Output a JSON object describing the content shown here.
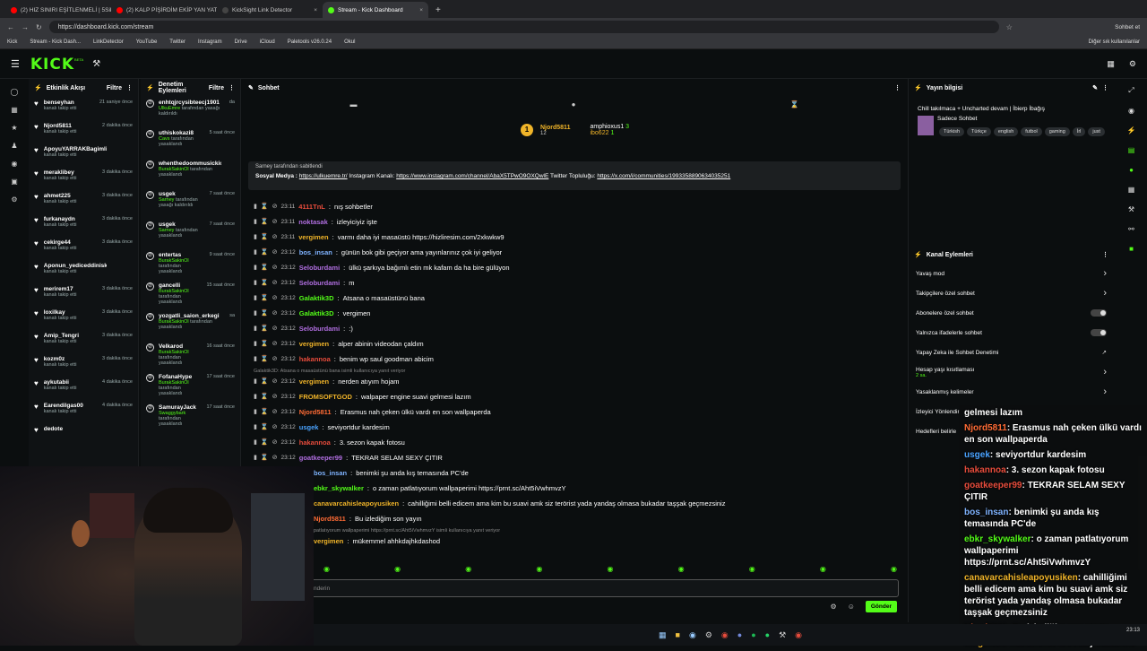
{
  "browser": {
    "tabs": [
      {
        "label": "(2) HIZ SINIRI EŞİTLENMELİ | 5Sik...",
        "icon": "youtube-icon",
        "color": "#ff0000"
      },
      {
        "label": "(2) KALP PİŞİRDİM EKİP YAN YATTI...",
        "icon": "youtube-icon",
        "color": "#ff0000"
      },
      {
        "label": "KickSight Link Detector",
        "icon": "kicksight-icon",
        "color": "#444444"
      },
      {
        "label": "Stream - Kick Dashboard",
        "icon": "kick-icon",
        "color": "#53fc18"
      }
    ],
    "url": "https://dashboard.kick.com/stream",
    "profile_label": "Sohbet et",
    "bookmarks": [
      "Kick",
      "Stream - Kick Dash...",
      "LinkDetector",
      "YouTube",
      "Twitter",
      "Instagram",
      "Drive",
      "iCloud",
      "Paletools v26.0.24",
      "Okul"
    ],
    "other_bookmarks": "Diğer sık kullanılanlar"
  },
  "kick": {
    "logo": "KICK",
    "logo_sup": "BETA"
  },
  "activity": {
    "title": "Etkinlik Akışı",
    "filter": "Filtre",
    "items": [
      {
        "name": "benseyhan",
        "sub": "kanalı takip etti",
        "time": "21 saniye önce"
      },
      {
        "name": "Njord5811",
        "sub": "kanalı takip etti",
        "time": "2 dakika önce"
      },
      {
        "name": "ApoyuYARRAKBagimlisiYap",
        "sub": "kanalı takip etti",
        "time": ""
      },
      {
        "name": "meraklibey",
        "sub": "kanalı takip etti",
        "time": "3 dakika önce"
      },
      {
        "name": "ahmet225",
        "sub": "kanalı takip etti",
        "time": "3 dakika önce"
      },
      {
        "name": "furkanaydn",
        "sub": "kanalı takip etti",
        "time": "3 dakika önce"
      },
      {
        "name": "cekirge44",
        "sub": "kanalı takip etti",
        "time": "3 dakika önce"
      },
      {
        "name": "Aponun_yediceddinisken",
        "sub": "kanalı takip etti",
        "time": ""
      },
      {
        "name": "merirem17",
        "sub": "kanalı takip etti",
        "time": "3 dakika önce"
      },
      {
        "name": "loxilkay",
        "sub": "kanalı takip etti",
        "time": "3 dakika önce"
      },
      {
        "name": "Amip_Tengri",
        "sub": "kanalı takip etti",
        "time": "3 dakika önce"
      },
      {
        "name": "kozm0z",
        "sub": "kanalı takip etti",
        "time": "3 dakika önce"
      },
      {
        "name": "aykutabii",
        "sub": "kanalı takip etti",
        "time": "4 dakika önce"
      },
      {
        "name": "Earendilgas00",
        "sub": "kanalı takip etti",
        "time": "4 dakika önce"
      },
      {
        "name": "dedote",
        "sub": "",
        "time": ""
      }
    ]
  },
  "moderation": {
    "title": "Denetim Eylemleri",
    "filter": "Filtre",
    "items": [
      {
        "name": "enhtqjrcysibteecj1901",
        "by": "UlkuEmre",
        "desc": "tarafından yasağı kaldırıldı",
        "time": "da"
      },
      {
        "name": "uthiskokazi8",
        "by": "Cavs",
        "desc": "tarafından yasaklandı",
        "time": "5 saat önce"
      },
      {
        "name": "whenthedoommusickicl",
        "by": "BurakSakinOl",
        "desc": "tarafından yasaklandı",
        "time": ""
      },
      {
        "name": "usgek",
        "by": "Sarney",
        "desc": "tarafından yasağı kaldırıldı",
        "time": "7 saat önce"
      },
      {
        "name": "usgek",
        "by": "Sarney",
        "desc": "tarafından yasaklandı",
        "time": "7 saat önce"
      },
      {
        "name": "entertas",
        "by": "BurakSakinOl",
        "desc": "tarafından yasaklandı",
        "time": "9 saat önce"
      },
      {
        "name": "gancelli",
        "by": "BurakSakinOl",
        "desc": "tarafından yasaklandı",
        "time": "15 saat önce"
      },
      {
        "name": "yozgatli_saion_erkegi",
        "by": "BurakSakinOl",
        "desc": "tarafından yasaklandı",
        "time": "sa"
      },
      {
        "name": "Velkarod",
        "by": "BurakSakinOl",
        "desc": "tarafından yasaklandı",
        "time": "16 saat önce"
      },
      {
        "name": "FofanaHype",
        "by": "BurakSakinOl",
        "desc": "tarafından yasaklandı",
        "time": "17 saat önce"
      },
      {
        "name": "SamurayJack",
        "by": "Swaggybark",
        "desc": "tarafından yasaklandı",
        "time": "17 saat önce"
      }
    ]
  },
  "chat": {
    "title": "Sohbet",
    "leaders": {
      "top": "Njord5811",
      "top_count": "12",
      "second": "amphioxus1",
      "second_count": "3",
      "third": "ibo622",
      "third_count": "1"
    },
    "pinned": {
      "by": "Sarney tarafından sabitlendi",
      "text_prefix": "Sosyal Medya :",
      "link1": "https://ulkuemre.tr/",
      "text_mid": "Instagram Kanalı:",
      "link2": "https://www.instagram.com/channel/AbaX5TPwO9OXQwlE",
      "text_mid2": "Twitter Topluluğu:",
      "link3": "https://x.com/i/communities/1993358890634035251"
    },
    "messages": [
      {
        "time": "23:11",
        "user": "4111TnL",
        "color": "#e74c3c",
        "text": "nış sohbetler"
      },
      {
        "time": "23:11",
        "user": "noktasak",
        "color": "#b06ee0",
        "text": "izleyiciyiz işte"
      },
      {
        "time": "23:11",
        "user": "vergimen",
        "color": "#f0b429",
        "text": "varmı daha iyi masaüstü https://hizliresim.com/2xkwkw9"
      },
      {
        "time": "23:12",
        "user": "bos_insan",
        "color": "#7fb3ff",
        "text": "günün bok gibi geçiyor ama yayınlarınız çok iyi geliyor"
      },
      {
        "time": "23:12",
        "user": "Seloburdami",
        "color": "#b06ee0",
        "text": "ülkü şarkıya bağımlı etin mk kafam da ha bire gülüyon"
      },
      {
        "time": "23:12",
        "user": "Seloburdami",
        "color": "#b06ee0",
        "text": "m"
      },
      {
        "time": "23:12",
        "user": "Galaktik3D",
        "color": "#53fc18",
        "text": "Atsana o masaüstünü bana"
      },
      {
        "time": "23:12",
        "user": "Galaktik3D",
        "color": "#53fc18",
        "text": "vergimen"
      },
      {
        "time": "23:12",
        "user": "Seloburdami",
        "color": "#b06ee0",
        "text": ":)"
      },
      {
        "time": "23:12",
        "user": "vergimen",
        "color": "#f0b429",
        "text": "alper abinin videodan çaldım"
      },
      {
        "time": "23:12",
        "user": "hakannoa",
        "color": "#e74c3c",
        "text": "benim wp saul goodman abicim"
      },
      {
        "time": "23:12",
        "user": "vergimen",
        "color": "#f0b429",
        "text": "nerden atıyım hojam"
      },
      {
        "time": "23:12",
        "user": "FROMSOFTGOD",
        "color": "#f0b429",
        "text": "walpaper engine suavi gelmesi lazım"
      },
      {
        "time": "23:12",
        "user": "Njord5811",
        "color": "#ff6b35",
        "text": "Erasmus nah çeken ülkü vardı en son wallpaperda"
      },
      {
        "time": "23:12",
        "user": "usgek",
        "color": "#4aa3ff",
        "text": "seviyortdur kardesim"
      },
      {
        "time": "23:12",
        "user": "hakannoa",
        "color": "#e74c3c",
        "text": "3. sezon kapak fotosu"
      },
      {
        "time": "23:12",
        "user": "goatkeeper99",
        "color": "#b06ee0",
        "text": "TEKRAR SELAM SEXY ÇITIR"
      }
    ],
    "lower_messages": [
      {
        "user": "bos_insan",
        "color": "#7fb3ff",
        "text": "benimki şu anda kış temasında PC'de"
      },
      {
        "user": "ebkr_skywalker",
        "color": "#53fc18",
        "text": "o zaman patlatıyorum wallpaperimi https://prnt.sc/Aht5iVwhmvzY"
      },
      {
        "user": "canavarcahisleapoyusiken",
        "color": "#f0b429",
        "text": "cahilliğimi belli edicem ama kim bu suavi amk siz terörist yada yandaş olmasa bukadar taşşak geçmezsiniz"
      },
      {
        "user": "Njord5811",
        "color": "#ff6b35",
        "text": "Bu izlediğim son yayın"
      },
      {
        "user": "vergimen",
        "color": "#f0b429",
        "text": "mükemmel ahhkdajhkdashod"
      }
    ],
    "reply1": "Galaktik3D: Atsana o masaüstünü bana isimli kullanıcıya yanıt veriyor",
    "reply2": "patlatıyorum wallpaperimi https://prnt.sc/Aht5iVwhmvzY isimli kullanıcıya yanıt veriyor",
    "input_placeholder": "nderin",
    "send_label": "Gönder"
  },
  "right": {
    "title": "Yayın bilgisi",
    "stream_title": "Chill takılmaca + Uncharted devam | İbierp İbağış",
    "category": "Sadece Sohbet",
    "tags": [
      "Türkish",
      "Türkçe",
      "english",
      "futbol",
      "gaming",
      "İrl",
      "just"
    ],
    "actions_title": "Kanal Eylemleri",
    "actions": [
      {
        "label": "Yavaş mod",
        "control": "chevron"
      },
      {
        "label": "Takipçilere özel sohbet",
        "control": "chevron"
      },
      {
        "label": "Abonelere özel sohbet",
        "control": "toggle"
      },
      {
        "label": "Yalnızca ifadelerle sohbet",
        "control": "toggle"
      },
      {
        "label": "Yapay Zeka ile Sohbet Denetimi",
        "control": "external"
      },
      {
        "label": "Hesap yaşı kısıtlaması",
        "sub": "2 sa.",
        "control": "chevron"
      },
      {
        "label": "Yasaklanmış kelimeler",
        "control": "chevron"
      },
      {
        "label": "İzleyici Yönlendir",
        "control": ""
      },
      {
        "label": "Hedefleri belirle",
        "control": ""
      }
    ]
  },
  "overlay_chat": [
    {
      "user": "gelmesi lazım",
      "color": "#ffffff",
      "text": ""
    },
    {
      "user": "Njord5811",
      "color": "#ff6b35",
      "text": ": Erasmus nah çeken ülkü vardı en son wallpaperda"
    },
    {
      "user": "usgek",
      "color": "#4aa3ff",
      "text": ": seviyortdur kardesim"
    },
    {
      "user": "hakannoa",
      "color": "#e74c3c",
      "text": ": 3. sezon kapak fotosu"
    },
    {
      "user": "goatkeeper99",
      "color": "#e74c3c",
      "text": ": TEKRAR SELAM SEXY ÇITIR"
    },
    {
      "user": "bos_insan",
      "color": "#7fb3ff",
      "text": ": benimki şu anda kış temasında PC'de"
    },
    {
      "user": "ebkr_skywalker",
      "color": "#53fc18",
      "text": ": o zaman patlatıyorum wallpaperimi https://prnt.sc/Aht5iVwhmvzY"
    },
    {
      "user": "canavarcahisleapoyusiken",
      "color": "#f0b429",
      "text": ": cahilliğimi belli edicem ama kim bu suavi amk siz terörist yada yandaş olmasa bukadar taşşak geçmezsiniz"
    },
    {
      "user": "Njord5811",
      "color": "#ff6b35",
      "text": ": Bu izlediğim son yayın"
    },
    {
      "user": "vergimen",
      "color": "#f0b429",
      "text": ": mükemmel ahhkdajhkdashod"
    }
  ],
  "taskbar": {
    "clock_time": "23:13",
    "clock_date": ""
  }
}
